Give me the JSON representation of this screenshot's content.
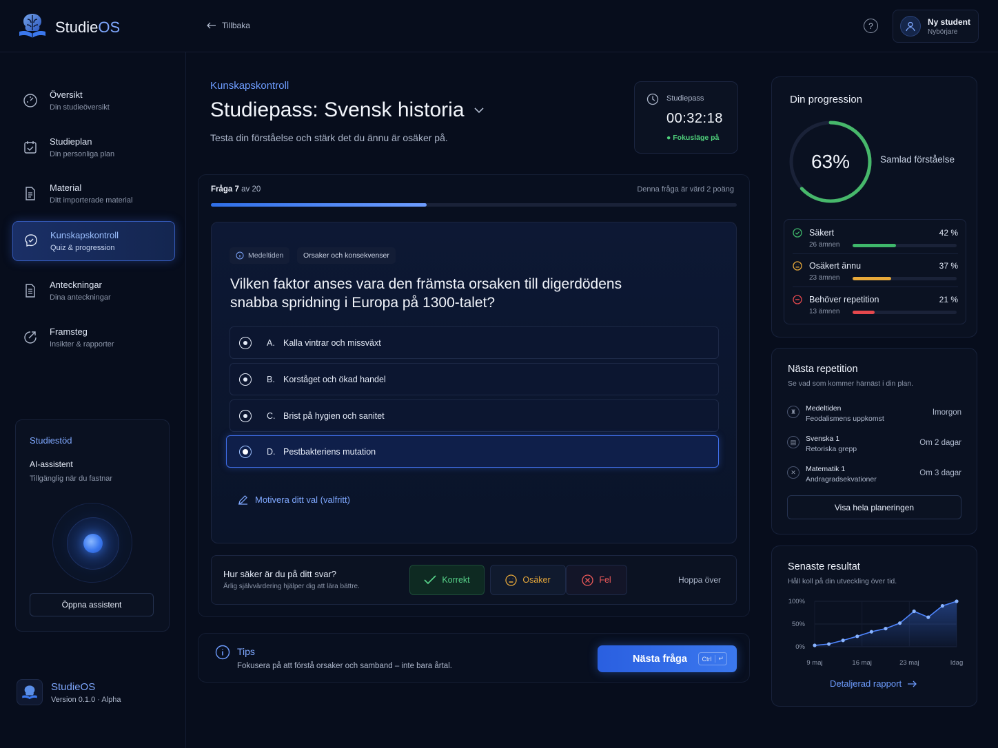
{
  "app": {
    "name_a": "Studie",
    "name_b": "OS",
    "footer_name": "StudieOS",
    "version": "Version 0.1.0 · Alpha"
  },
  "header": {
    "back_label": "Tillbaka",
    "help_icon": "help-circle-icon",
    "user_name": "Ny student",
    "user_role": "Nybörjare"
  },
  "sidebar": {
    "items": [
      {
        "title": "Översikt",
        "sub": "Din studieöversikt",
        "icon": "dashboard-icon"
      },
      {
        "title": "Studieplan",
        "sub": "Din personliga plan",
        "icon": "calendar-check-icon"
      },
      {
        "title": "Material",
        "sub": "Ditt importerade material",
        "icon": "document-icon"
      },
      {
        "title": "Kunskapskontroll",
        "sub": "Quiz & progression",
        "icon": "brain-check-icon",
        "active": true
      },
      {
        "title": "Anteckningar",
        "sub": "Dina anteckningar",
        "icon": "notes-icon"
      },
      {
        "title": "Framsteg",
        "sub": "Insikter & rapporter",
        "icon": "progress-icon"
      }
    ],
    "support": {
      "title": "Studiestöd",
      "assistant": "AI-assistent",
      "assistant_sub": "Tillgänglig när du fastnar",
      "button": "Öppna assistent"
    }
  },
  "main": {
    "eyebrow": "Kunskapskontroll",
    "title": "Studiepass: Svensk historia",
    "subtitle": "Testa din förståelse och stärk det du ännu är osäker på.",
    "timer": {
      "label": "Studiepass",
      "value": "00:32:18",
      "focus": "Fokusläge på"
    },
    "quiz": {
      "question_label": "Fråga 7",
      "question_of": "av 20",
      "points": "Denna fråga är värd 2 poäng",
      "progress": 0.41,
      "tags": [
        "Medeltiden",
        "Orsaker och konsekvenser"
      ],
      "question": "Vilken faktor anses vara den främsta orsaken till digerdödens snabba spridning i Europa på 1300-talet?",
      "options": [
        {
          "letter": "A.",
          "text": "Kalla vintrar och missväxt"
        },
        {
          "letter": "B.",
          "text": "Korståget och ökad handel"
        },
        {
          "letter": "C.",
          "text": "Brist på hygien och sanitet"
        },
        {
          "letter": "D.",
          "text": "Pestbakteriens mutation",
          "selected": true
        }
      ],
      "motivate": "Motivera ditt val (valfritt)"
    },
    "confidence": {
      "question": "Hur säker är du på ditt svar?",
      "sub": "Ärlig självvärdering hjälper dig att lära bättre.",
      "correct": "Korrekt",
      "unsure": "Osäker",
      "wrong": "Fel",
      "skip": "Hoppa över"
    },
    "tips": {
      "title": "Tips",
      "text": "Fokusera på att förstå orsaker och samband – inte bara årtal."
    },
    "next_button": "Nästa fråga",
    "shortcut": "Ctrl"
  },
  "progression": {
    "title": "Din progression",
    "percent_label": "63%",
    "percent": 63,
    "ring_label": "Samlad förståelse",
    "stats": [
      {
        "label": "Säkert",
        "sub": "26 ämnen",
        "pct_label": "42 %",
        "pct": 42,
        "color": "#3fb86b"
      },
      {
        "label": "Osäkert ännu",
        "sub": "23 ämnen",
        "pct_label": "37 %",
        "pct": 37,
        "color": "#e8a93a"
      },
      {
        "label": "Behöver repetition",
        "sub": "13 ämnen",
        "pct_label": "21 %",
        "pct": 21,
        "color": "#e5484d"
      }
    ]
  },
  "next_repetition": {
    "title": "Nästa repetition",
    "sub": "Se vad som kommer härnäst i din plan.",
    "items": [
      {
        "subject": "Medeltiden",
        "topic": "Feodalismens uppkomst",
        "when": "Imorgon"
      },
      {
        "subject": "Svenska 1",
        "topic": "Retoriska grepp",
        "when": "Om 2 dagar"
      },
      {
        "subject": "Matematik 1",
        "topic": "Andragradsekvationer",
        "when": "Om 3 dagar"
      }
    ],
    "button": "Visa hela planeringen"
  },
  "results": {
    "title": "Senaste resultat",
    "sub": "Håll koll på din utveckling över tid.",
    "link": "Detaljerad rapport"
  },
  "chart_data": {
    "type": "line",
    "title": "",
    "xlabel": "",
    "ylabel": "",
    "y_ticks": [
      "100%",
      "50%",
      "0%"
    ],
    "x_ticks": [
      "9 maj",
      "16 maj",
      "23 maj",
      "Idag"
    ],
    "ylim": [
      0,
      100
    ],
    "values": [
      3,
      6,
      14,
      23,
      33,
      40,
      52,
      78,
      65,
      90,
      100
    ],
    "series_color": "#4f86ff",
    "grid": true,
    "legend": "none"
  }
}
